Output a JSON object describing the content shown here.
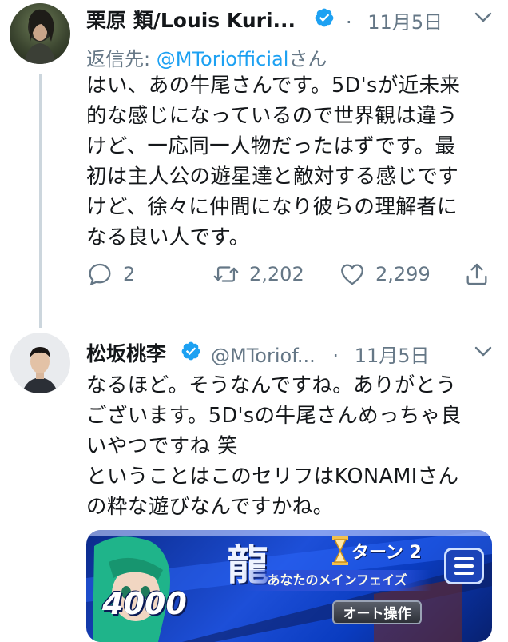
{
  "tweet1": {
    "display_name": "栗原 類/Louis Kuri...",
    "date": "11月5日",
    "reply_prefix": "返信先:",
    "reply_handle": "@MToriofficial",
    "reply_suffix": "さん",
    "text": "はい、あの牛尾さんです。5D'sが近未来\n的な感じになっているので世界観は違う\nけど、一応同一人物だったはずです。最\n初は主人公の遊星達と敵対する感じです\nけど、徐々に仲間になり彼らの理解者に\nなる良い人です。",
    "replies": "2",
    "retweets": "2,202",
    "likes": "2,299"
  },
  "tweet2": {
    "display_name": "松坂桃李",
    "handle": "@MToriof...",
    "date": "11月5日",
    "text": "なるほど。そうなんですね。ありがとう\nございます。5D'sの牛尾さんめっちゃ良\nいやつですね 笑\nということはこのセリフはKONAMIさん\nの粋な遊びなんですかね。",
    "card": {
      "dragon_text": "龍",
      "turn_text": "ターン 2",
      "phase_text": "あなたのメインフェイズ",
      "life_points": "4000",
      "auto_button": "オート操作"
    }
  },
  "icons": [
    "verified-badge-icon",
    "chevron-down-icon",
    "reply-icon",
    "retweet-icon",
    "like-icon",
    "share-icon",
    "menu-icon",
    "hourglass-icon"
  ],
  "colors": {
    "accent": "#1da1f2",
    "muted": "#657786",
    "thread_line": "#ccd6dd"
  }
}
